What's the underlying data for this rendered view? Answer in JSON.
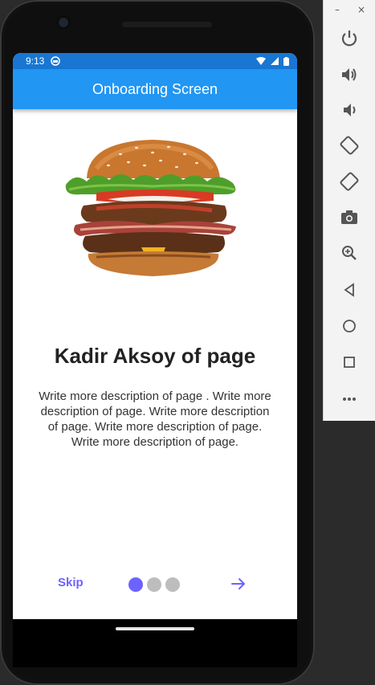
{
  "status_bar": {
    "time": "9:13"
  },
  "app_bar": {
    "title": "Onboarding Screen"
  },
  "onboarding": {
    "image": "burger-image",
    "title": "Kadir Aksoy of page",
    "description": "Write more description of page . Write more description of page. Write more description of page. Write more description of page. Write more description of page.",
    "skip_label": "Skip",
    "page_count": 3,
    "current_page": 1
  },
  "emulator_panel": {
    "window_controls": {
      "minimize": "–",
      "close": "×"
    },
    "tools": [
      "power-icon",
      "volume-up-icon",
      "volume-down-icon",
      "rotate-left-icon",
      "rotate-right-icon",
      "camera-icon",
      "zoom-icon",
      "back-icon",
      "home-icon",
      "overview-icon",
      "more-icon"
    ]
  },
  "colors": {
    "app_bar": "#2196f3",
    "status_bar": "#1976d2",
    "accent": "#6c63ff",
    "dot_inactive": "#bdbdbd"
  }
}
